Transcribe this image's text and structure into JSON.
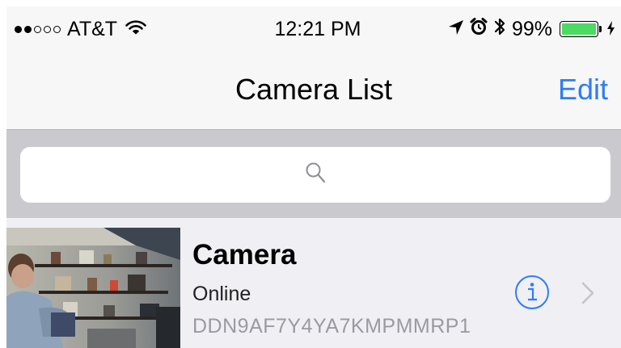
{
  "status_bar": {
    "carrier": "AT&T",
    "signal_dots_filled": 2,
    "signal_dots_total": 5,
    "time": "12:21 PM",
    "battery": "99%",
    "battery_level": 0.99,
    "icons": [
      "wifi-icon",
      "location-arrow-icon",
      "alarm-icon",
      "bluetooth-icon",
      "battery-icon",
      "charging-bolt-icon"
    ],
    "battery_color": "#4cd964"
  },
  "nav": {
    "title": "Camera List",
    "edit_label": "Edit",
    "accent_color": "#2f7cf6"
  },
  "search": {
    "placeholder": "",
    "icon": "search-icon"
  },
  "cameras": [
    {
      "name": "Camera",
      "status": "Online",
      "id": "DDN9AF7Y4YA7KMPMMRP1",
      "icons": [
        "info-icon",
        "chevron-right-icon"
      ]
    }
  ]
}
